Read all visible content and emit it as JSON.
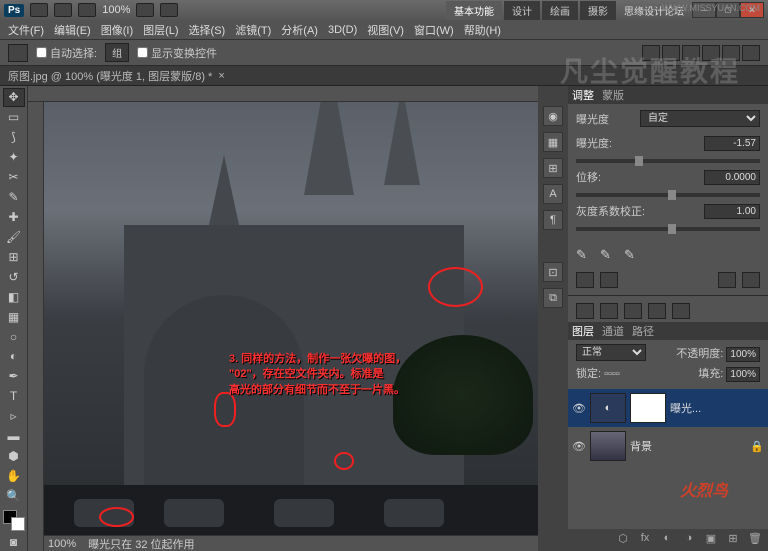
{
  "titlebar": {
    "logo": "Ps",
    "zoom": "100%",
    "tabs": [
      "基本功能",
      "设计",
      "绘画",
      "摄影"
    ],
    "active_tab": 0,
    "watermark_url": "WWW.MISSYUAN.COM",
    "forum": "思缘设计论坛"
  },
  "menu": [
    "文件(F)",
    "编辑(E)",
    "图像(I)",
    "图层(L)",
    "选择(S)",
    "滤镜(T)",
    "分析(A)",
    "3D(D)",
    "视图(V)",
    "窗口(W)",
    "帮助(H)"
  ],
  "options": {
    "auto_select": "自动选择:",
    "auto_select_val": "组",
    "show_transform": "显示变换控件"
  },
  "doc_tab": "原图.jpg @ 100% (曝光度 1, 图层蒙版/8) *",
  "annotation": {
    "line1": "3. 同样的方法，制作一张欠曝的图，",
    "line2": "\"02\"，存在空文件夹内。标准是",
    "line3": "高光的部分有细节而不至于一片黑。"
  },
  "status": {
    "zoom": "100%",
    "info": "曝光只在 32 位起作用"
  },
  "adjustments": {
    "tab1": "调整",
    "tab2": "蒙版",
    "type_label": "曝光度",
    "preset": "自定",
    "exposure_label": "曝光度:",
    "exposure_val": "-1.57",
    "offset_label": "位移:",
    "offset_val": "0.0000",
    "gamma_label": "灰度系数校正:",
    "gamma_val": "1.00"
  },
  "layers_panel": {
    "tabs": [
      "图层",
      "通道",
      "路径"
    ],
    "blend": "正常",
    "opacity_label": "不透明度:",
    "opacity": "100%",
    "lock_label": "锁定:",
    "fill_label": "填充:",
    "fill": "100%",
    "items": [
      {
        "name": "曝光...",
        "adj": true
      },
      {
        "name": "背景",
        "locked": true
      }
    ]
  },
  "watermark_big": "凡尘觉醒教程",
  "watermark_fire": "火烈鸟"
}
